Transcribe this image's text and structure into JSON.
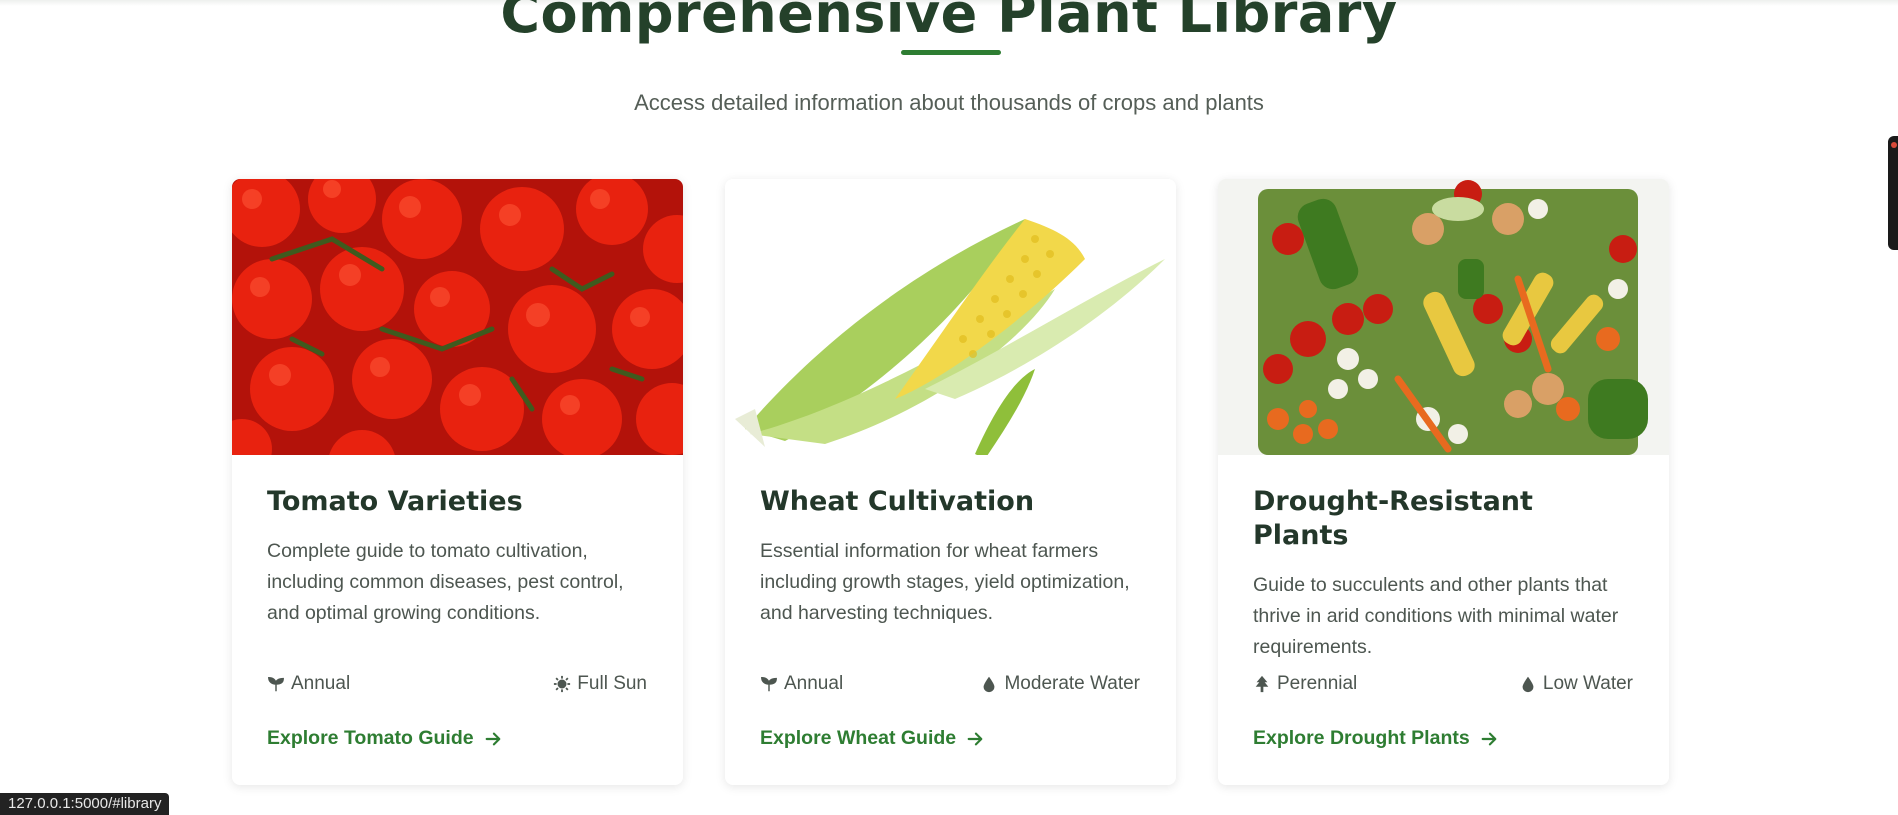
{
  "section": {
    "title": "Comprehensive Plant Library",
    "subtitle": "Access detailed information about thousands of crops and plants"
  },
  "colors": {
    "accent": "#2e7d32",
    "heading": "#23372a",
    "text": "#4d5650"
  },
  "cards": [
    {
      "image": "tomatoes-photo",
      "title": "Tomato Varieties",
      "description": "Complete guide to tomato cultivation, including common diseases, pest control, and optimal growing conditions.",
      "meta_left": {
        "icon": "seedling-icon",
        "label": "Annual"
      },
      "meta_right": {
        "icon": "sun-icon",
        "label": "Full Sun"
      },
      "link": "Explore Tomato Guide"
    },
    {
      "image": "corn-photo",
      "title": "Wheat Cultivation",
      "description": "Essential information for wheat farmers including growth stages, yield optimization, and harvesting techniques.",
      "meta_left": {
        "icon": "seedling-icon",
        "label": "Annual"
      },
      "meta_right": {
        "icon": "water-drop-icon",
        "label": "Moderate Water"
      },
      "link": "Explore Wheat Guide"
    },
    {
      "image": "vegetables-photo",
      "title": "Drought-Resistant Plants",
      "description": "Guide to succulents and other plants that thrive in arid conditions with minimal water requirements.",
      "meta_left": {
        "icon": "tree-icon",
        "label": "Perennial"
      },
      "meta_right": {
        "icon": "water-drop-icon",
        "label": "Low Water"
      },
      "link": "Explore Drought Plants"
    }
  ],
  "status_bar": {
    "url": "127.0.0.1:5000/#library"
  }
}
